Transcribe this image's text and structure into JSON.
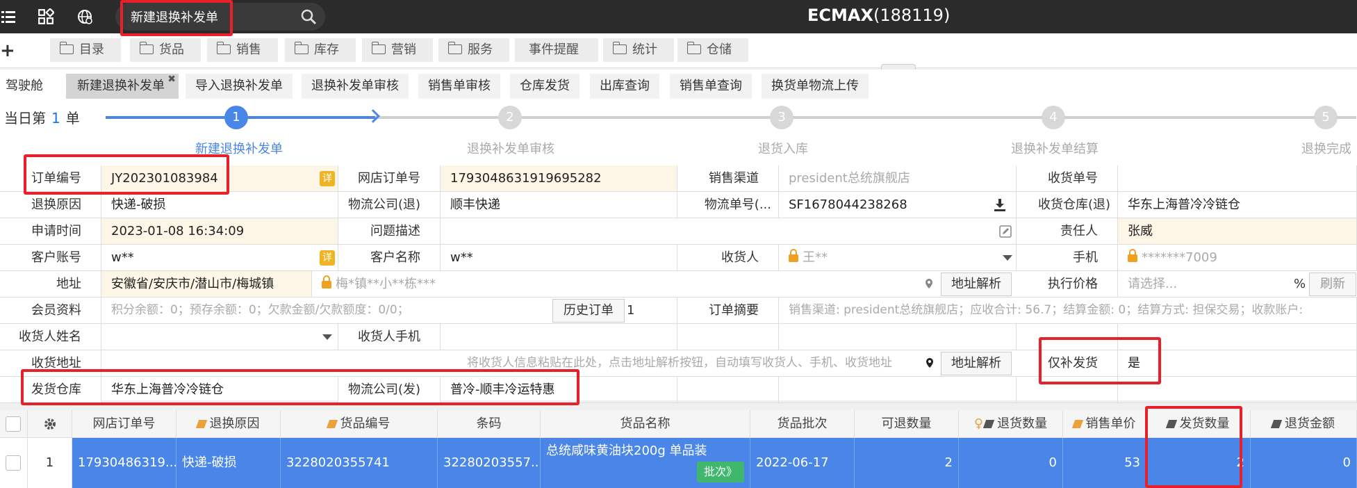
{
  "header": {
    "search_value": "新建退换补发单",
    "brand": "ECMAX",
    "brand_id": "(188119)",
    "icons": [
      "menu-icon",
      "grid-icon",
      "globe-icon",
      "search-icon"
    ]
  },
  "menu": [
    "目录",
    "货品",
    "销售",
    "库存",
    "营销",
    "服务",
    "事件提醒",
    "统计",
    "仓储"
  ],
  "tabs": [
    "驾驶舱",
    "新建退换补发单",
    "导入退换补发单",
    "退换补发单审核",
    "销售单审核",
    "仓库发货",
    "出库查询",
    "销售单查询",
    "换货单物流上传"
  ],
  "today": {
    "prefix": "当日第",
    "count": "1",
    "suffix": "单"
  },
  "steps": [
    {
      "num": "1",
      "label": "新建退换补发单"
    },
    {
      "num": "2",
      "label": "退换补发单审核"
    },
    {
      "num": "3",
      "label": "退货入库"
    },
    {
      "num": "4",
      "label": "退换补发单结算"
    },
    {
      "num": "5",
      "label": "退换完成"
    }
  ],
  "form": {
    "order_no_label": "订单编号",
    "order_no": "JY202301083984",
    "detail_badge": "详",
    "shop_order_label": "网店订单号",
    "shop_order": "1793048631919695282",
    "channel_label": "销售渠道",
    "channel": "president总统旗舰店",
    "receipt_no_label": "收货单号",
    "receipt_no": "",
    "reason_label": "退换原因",
    "reason": "快递-破损",
    "logi_ret_label": "物流公司(退)",
    "logi_ret": "顺丰快递",
    "tracking_label": "物流单号(...",
    "tracking": "SF1678044238268",
    "wh_ret_label": "收货仓库(退)",
    "wh_ret": "华东上海普冷冷链仓",
    "apply_time_label": "申请时间",
    "apply_time": "2023-01-08 16:34:09",
    "issue_label": "问题描述",
    "issue": "",
    "owner_label": "责任人",
    "owner": "张威",
    "account_label": "客户账号",
    "account": "w**",
    "cust_name_label": "客户名称",
    "cust_name": "w**",
    "receiver_label": "收货人",
    "receiver": "王**",
    "phone_label": "手机",
    "phone": "*******7009",
    "address_label": "地址",
    "address": "安徽省/安庆市/潜山市/梅城镇",
    "address_detail": "梅*镇**小**栋***",
    "parse_btn": "地址解析",
    "price_label": "执行价格",
    "price_placeholder": "请选择...",
    "price_unit": "%",
    "refresh_btn": "刷新",
    "member_label": "会员资料",
    "member": "积分余额：0；预存余额：0；欠款金额/欠款额度：0/0；",
    "history_btn": "历史订单",
    "history_count": "1",
    "summary_label": "订单摘要",
    "summary": "销售渠道: president总统旗舰店；应收合计: 56.7；结算金额: 0；结算方式: 担保交易；收款账户:",
    "recv_name_label": "收货人姓名",
    "recv_name": "",
    "recv_phone_label": "收货人手机",
    "recv_phone": "",
    "recv_addr_label": "收货地址",
    "recv_addr_placeholder": "将收货人信息粘贴在此处，点击地址解析按钮，自动填写收货人、手机、收货地址",
    "only_resend_label": "仅补发货",
    "only_resend": "是",
    "ship_wh_label": "发货仓库",
    "ship_wh": "华东上海普冷冷链仓",
    "logi_send_label": "物流公司(发)",
    "logi_send": "普冷-顺丰冷运特惠"
  },
  "grid": {
    "headers": [
      "网店订单号",
      "退换原因",
      "货品编号",
      "条码",
      "货品名称",
      "货品批次",
      "可退数量",
      "退货数量",
      "销售单价",
      "发货数量",
      "退货金额"
    ],
    "row": {
      "idx": "1",
      "shop_order": "17930486319...",
      "reason": "快递-破损",
      "goods_no": "3228020355741",
      "barcode": "32280203557...",
      "goods_name": "总统咸味黄油块200g 单品装",
      "batch_btn": "批次》",
      "batch": "2022-06-17",
      "returnable": "2",
      "return_qty": "0",
      "unit_price": "53",
      "ship_qty": "2",
      "return_amount": "0"
    }
  },
  "colors": {
    "accent": "#4a86e8",
    "highlight": "#e8202a",
    "topbar": "#2b2b2b",
    "badge": "#f0b323",
    "batch": "#3fb86e"
  }
}
